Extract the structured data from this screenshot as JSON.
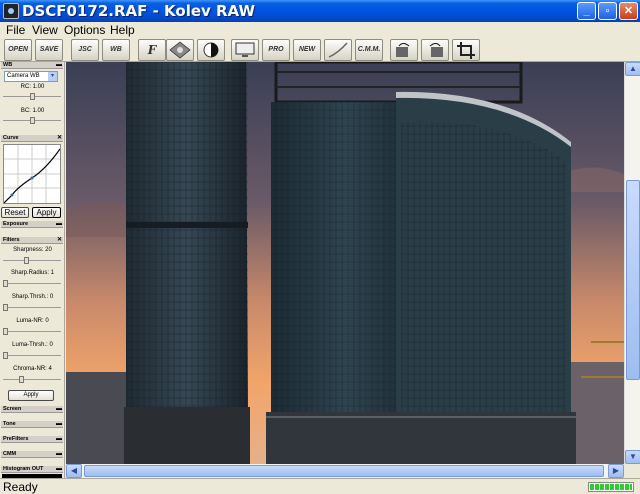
{
  "window": {
    "title": "DSCF0172.RAF - Kolev RAW",
    "minimize_icon": "minimize-icon",
    "maximize_icon": "restore-icon",
    "close_icon": "close-icon"
  },
  "menu": [
    "File",
    "View",
    "Options",
    "Help"
  ],
  "toolbar": {
    "buttons": [
      {
        "label": "OPEN",
        "icon": "open-icon"
      },
      {
        "label": "SAVE",
        "icon": "save-icon"
      },
      {
        "label": "JSC",
        "icon": "jsc-icon"
      },
      {
        "label": "WB",
        "icon": "white-balance-icon"
      },
      {
        "label": "F",
        "icon": "filters-icon"
      },
      {
        "label": "",
        "icon": "rotate-icon"
      },
      {
        "label": "",
        "icon": "contrast-icon"
      },
      {
        "label": "",
        "icon": "screen-icon"
      },
      {
        "label": "PRO",
        "icon": "profile-icon"
      },
      {
        "label": "NEW",
        "icon": "new-icon"
      },
      {
        "label": "",
        "icon": "curve-icon"
      },
      {
        "label": "C.M.M.",
        "icon": "cmm-icon"
      },
      {
        "label": "",
        "icon": "rotate-left-icon"
      },
      {
        "label": "",
        "icon": "rotate-right-icon"
      },
      {
        "label": "",
        "icon": "crop-icon"
      }
    ]
  },
  "panels": {
    "wb": {
      "title": "WB",
      "select_value": "Camera WB",
      "rc_label": "RC: 1.00",
      "rc_value": 0.5,
      "bc_label": "BC: 1.00",
      "bc_value": 0.5
    },
    "curve": {
      "title": "Curve",
      "reset": "Reset",
      "apply": "Apply"
    },
    "exposure": {
      "title": "Exposure"
    },
    "filters": {
      "title": "Filters",
      "sharpness": "Sharpness: 20",
      "sharpness_value": 0.4,
      "sharp_radius": "Sharp.Radius: 1",
      "sharp_radius_value": 0.0,
      "sharp_thrsh": "Sharp.Thrsh.: 0",
      "sharp_thrsh_value": 0.0,
      "luma_nr": "Luma-NR: 0",
      "luma_nr_value": 0.0,
      "luma_thrsh": "Luma-Thrsh.: 0",
      "luma_thrsh_value": 0.0,
      "chroma_nr": "Chroma-NR: 4",
      "chroma_nr_value": 0.3,
      "apply": "Apply"
    },
    "screen": {
      "title": "Screen"
    },
    "tone": {
      "title": "Tone"
    },
    "prefilters": {
      "title": "PreFilters"
    },
    "cmm": {
      "title": "CMM"
    },
    "histogram": {
      "title": "Histogram OUT"
    }
  },
  "status": {
    "text": "Ready",
    "progress": 1.0
  },
  "colors": {
    "titlebar": "#0054e3",
    "progress": "#2ecc2e",
    "sky_top": "#3a3f55",
    "sky_bottom": "#f2a56a"
  }
}
